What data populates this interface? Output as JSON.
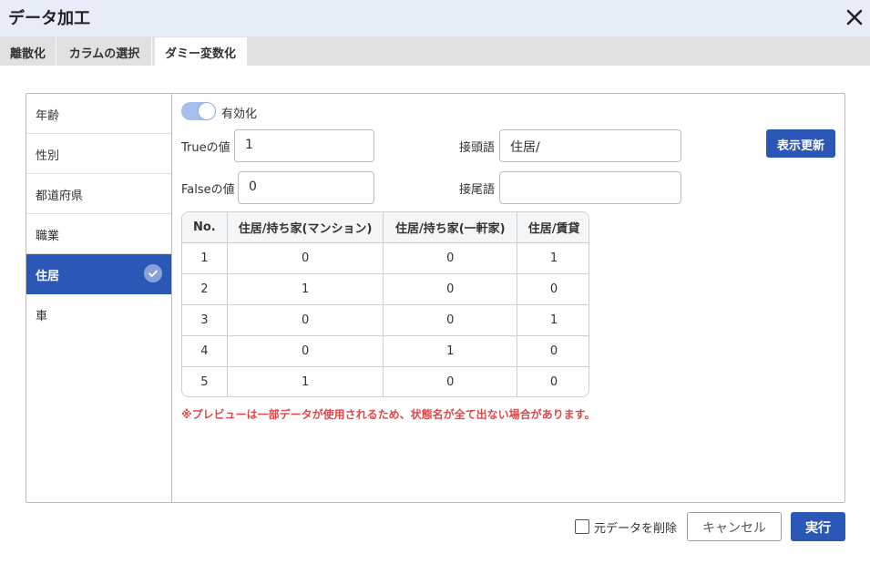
{
  "dialog": {
    "title": "データ加工"
  },
  "tabs": [
    {
      "label": "離散化"
    },
    {
      "label": "カラムの選択"
    },
    {
      "label": "ダミー変数化"
    }
  ],
  "sidebar": {
    "items": [
      {
        "label": "年齢"
      },
      {
        "label": "性別"
      },
      {
        "label": "都道府県"
      },
      {
        "label": "職業"
      },
      {
        "label": "住居",
        "selected": true
      },
      {
        "label": "車"
      }
    ]
  },
  "settings": {
    "enable_label": "有効化",
    "enabled": true,
    "true_label": "Trueの値",
    "true_value": "1",
    "false_label": "Falseの値",
    "false_value": "0",
    "prefix_label": "接頭語",
    "prefix_value": "住居/",
    "suffix_label": "接尾語",
    "suffix_value": "",
    "refresh_button": "表示更新"
  },
  "preview_table": {
    "headers": [
      "No.",
      "住居/持ち家(マンション)",
      "住居/持ち家(一軒家)",
      "住居/賃貸"
    ],
    "rows": [
      [
        "1",
        "0",
        "0",
        "1"
      ],
      [
        "2",
        "1",
        "0",
        "0"
      ],
      [
        "3",
        "0",
        "0",
        "1"
      ],
      [
        "4",
        "0",
        "1",
        "0"
      ],
      [
        "5",
        "1",
        "0",
        "0"
      ]
    ]
  },
  "warning": "※プレビューは一部データが使用されるため、状態名が全て出ない場合があります。",
  "footer": {
    "delete_original_label": "元データを削除",
    "delete_original_checked": false,
    "cancel_button": "キャンセル",
    "execute_button": "実行"
  },
  "colors": {
    "accent": "#2b57b7",
    "warning": "#e04848",
    "titlebar": "#e8ecf7"
  }
}
